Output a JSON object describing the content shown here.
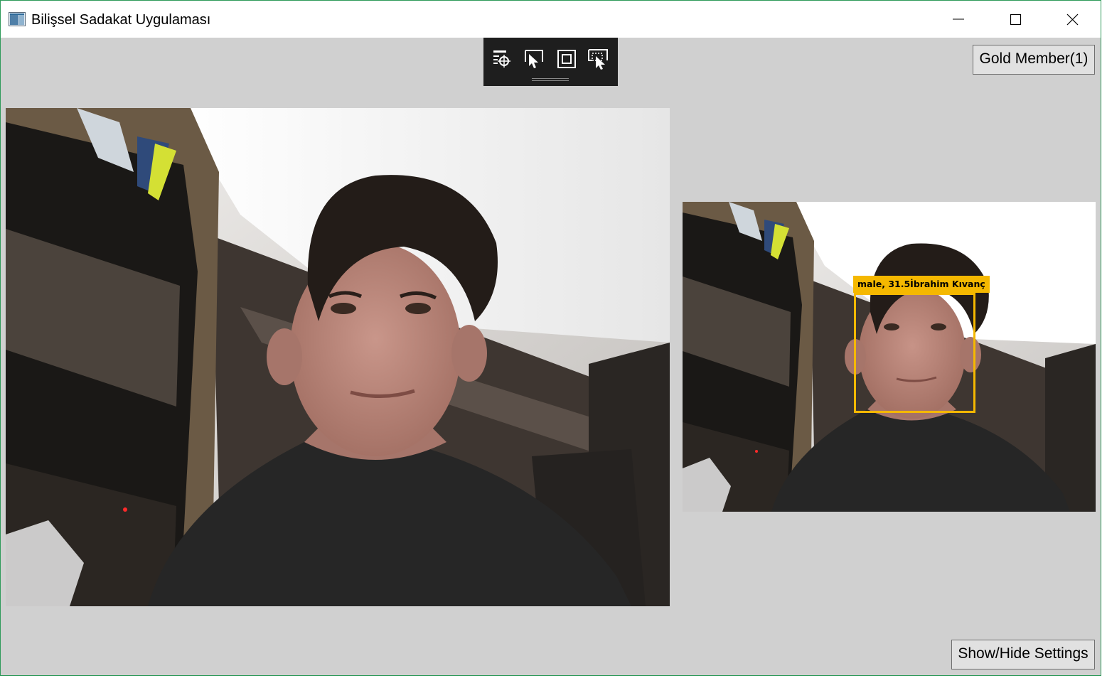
{
  "window": {
    "title": "Bilişsel Sadakat Uygulaması"
  },
  "title_bar_controls": {
    "minimize_icon": "minimize-icon",
    "maximize_icon": "maximize-icon",
    "close_icon": "close-icon"
  },
  "debug_toolbar": {
    "tools": [
      {
        "icon": "live-visual-tree-icon"
      },
      {
        "icon": "select-element-icon"
      },
      {
        "icon": "display-layout-adorners-icon"
      },
      {
        "icon": "track-focused-element-icon"
      }
    ]
  },
  "buttons": {
    "gold_member": "Gold Member(1)",
    "show_hide_settings": "Show/Hide Settings"
  },
  "analyzed_feed": {
    "face_label": "male, 31.5İbrahim Kıvanç",
    "highlight_color": "#f5b800"
  }
}
